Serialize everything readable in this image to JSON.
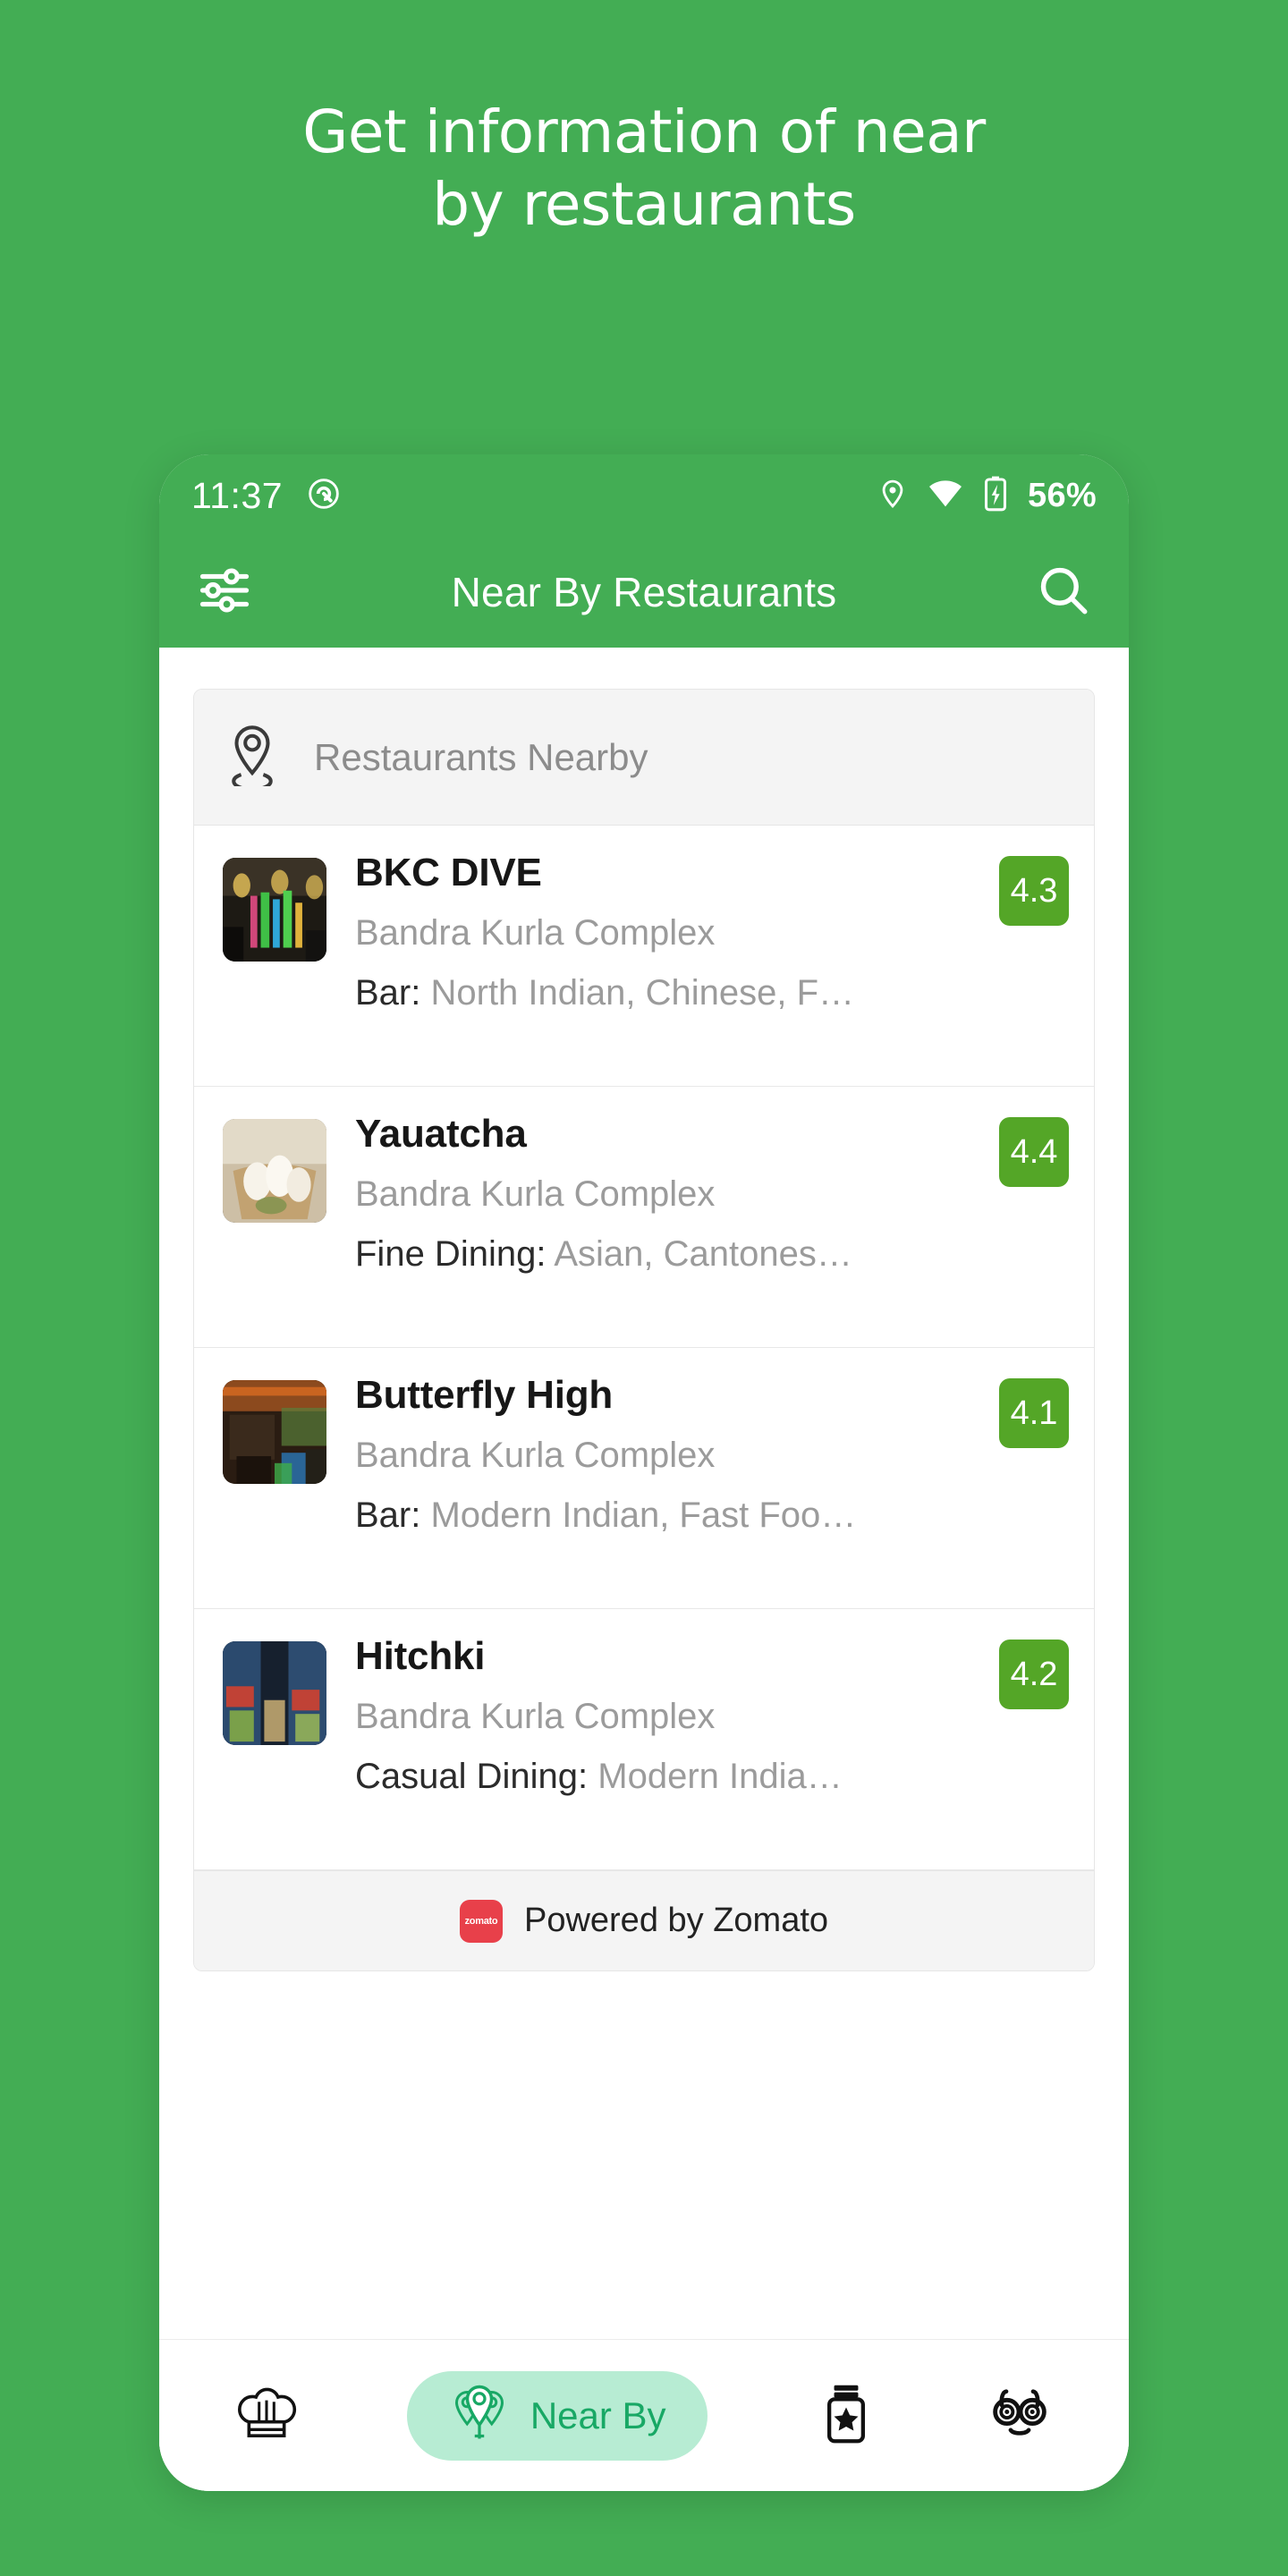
{
  "promo": {
    "headline_line1": "Get information of near",
    "headline_line2": "by restaurants",
    "background_color": "#43ad54"
  },
  "status_bar": {
    "time": "11:37",
    "icons": [
      "android-q-icon",
      "location-pin-icon",
      "wifi-icon",
      "battery-charging-icon"
    ],
    "battery_percent": "56%"
  },
  "app_bar": {
    "title": "Near By Restaurants",
    "left_icon": "tune-filter-icon",
    "right_icon": "search-icon",
    "background_color": "#43ad54"
  },
  "list_header": {
    "icon": "location-pin-icon",
    "label": "Restaurants Nearby"
  },
  "restaurants": [
    {
      "name": "BKC DIVE",
      "location": "Bandra Kurla Complex",
      "category": "Bar:",
      "cuisines": "North Indian, Chinese, F…",
      "rating": "4.3"
    },
    {
      "name": "Yauatcha",
      "location": "Bandra Kurla Complex",
      "category": "Fine Dining:",
      "cuisines": "Asian, Cantones…",
      "rating": "4.4"
    },
    {
      "name": "Butterfly High",
      "location": "Bandra Kurla Complex",
      "category": "Bar:",
      "cuisines": "Modern Indian, Fast Foo…",
      "rating": "4.1"
    },
    {
      "name": "Hitchki",
      "location": "Bandra Kurla Complex",
      "category": "Casual Dining:",
      "cuisines": "Modern India…",
      "rating": "4.2"
    }
  ],
  "footer": {
    "logo_text": "zomato",
    "label": "Powered by Zomato",
    "logo_color": "#e8404a"
  },
  "bottom_nav": {
    "items": [
      {
        "icon": "chef-hat-icon",
        "label": "",
        "active": false
      },
      {
        "icon": "near-by-pins-icon",
        "label": "Near By",
        "active": true
      },
      {
        "icon": "jar-star-icon",
        "label": "",
        "active": false
      },
      {
        "icon": "glasses-face-icon",
        "label": "",
        "active": false
      }
    ],
    "active_pill_color": "#b7ecd3",
    "active_text_color": "#18a865"
  },
  "theme": {
    "rating_badge_color": "#54a627",
    "accent_green": "#43ad54"
  }
}
